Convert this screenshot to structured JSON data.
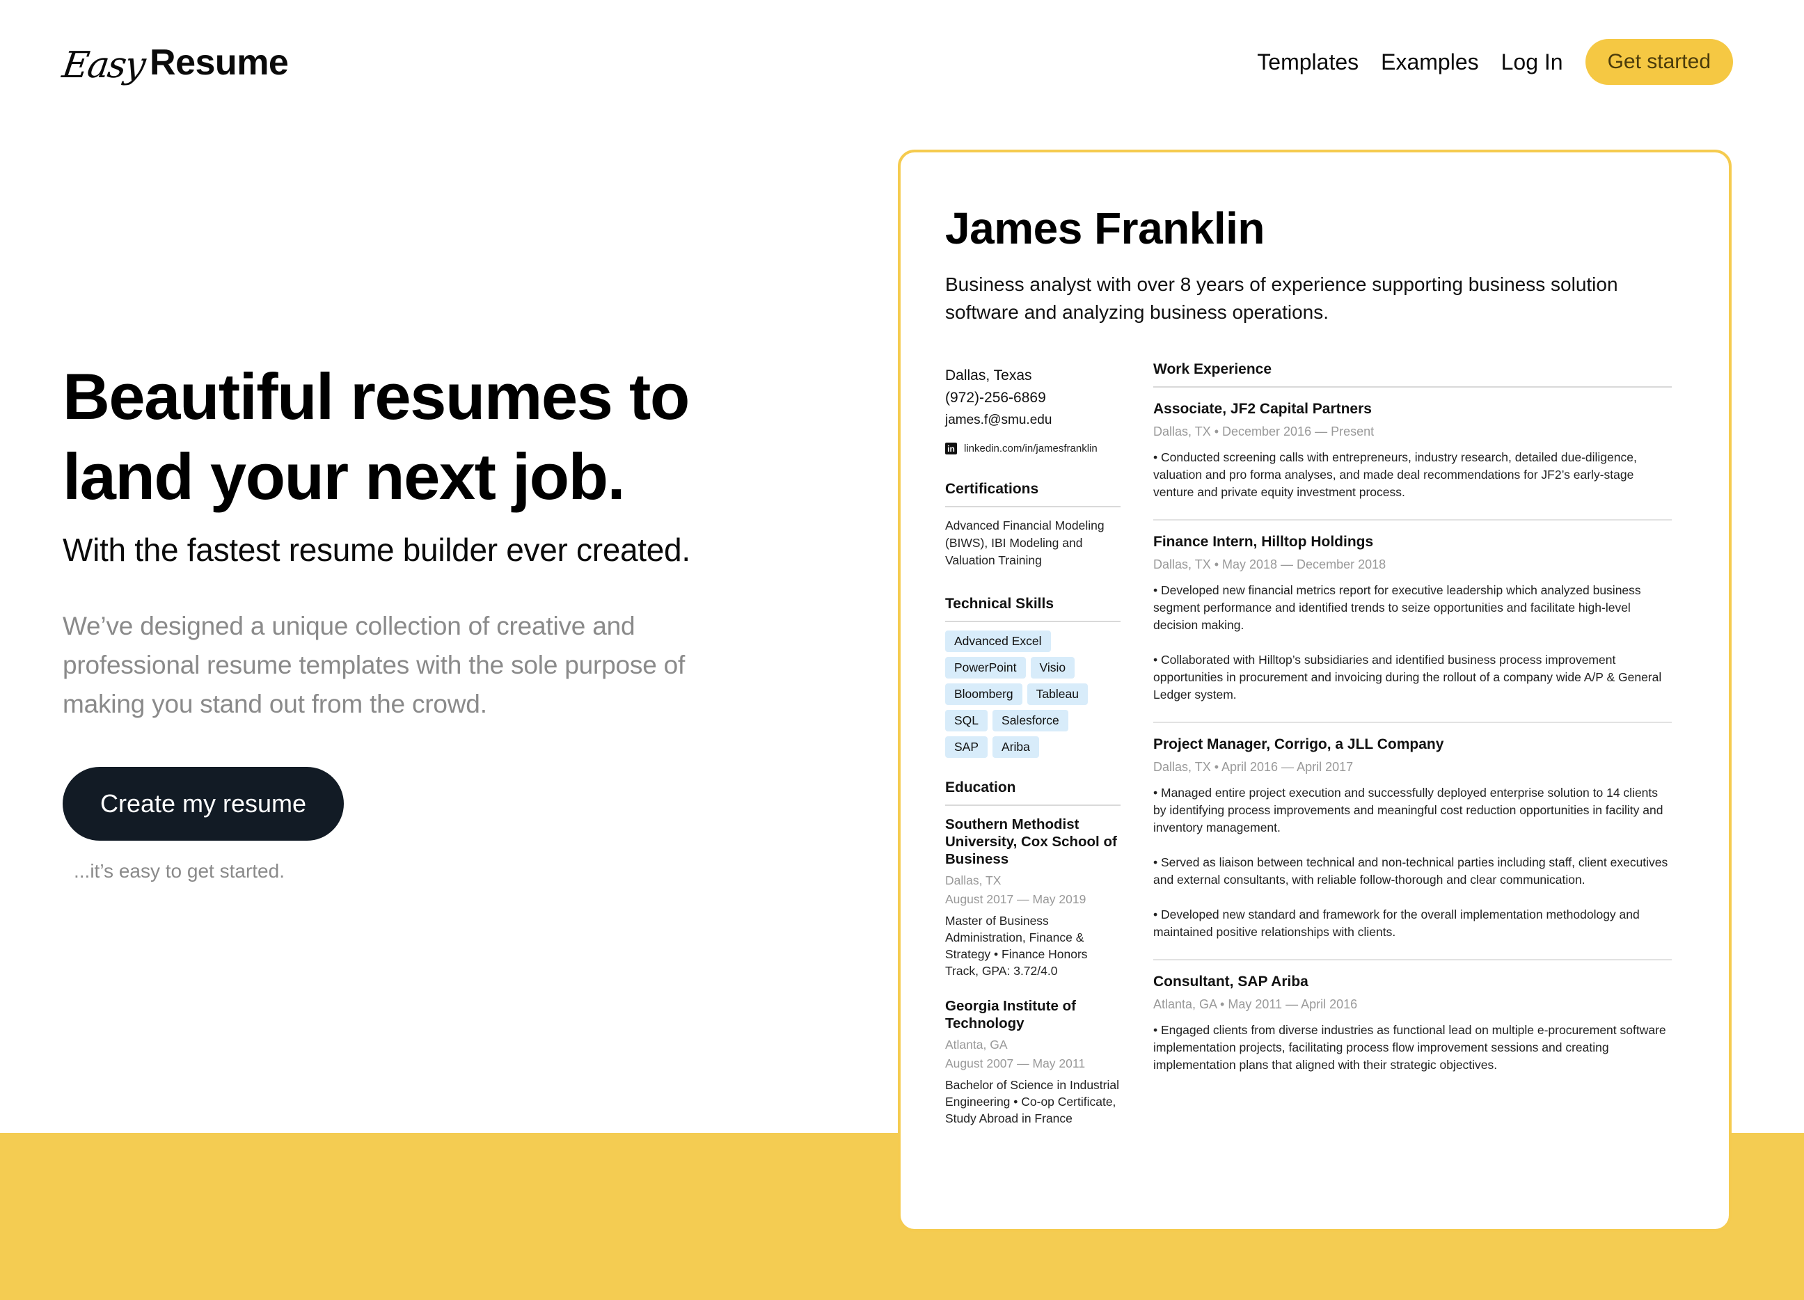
{
  "brand": {
    "script": "Easy",
    "bold": "Resume",
    "accent_color": "#F4CC52",
    "dark_color": "#121B25"
  },
  "nav": {
    "links": [
      "Templates",
      "Examples",
      "Log In"
    ],
    "cta": "Get started"
  },
  "hero": {
    "title_line1": "Beautiful resumes to",
    "title_line2": "land your next job.",
    "subtitle": "With the fastest resume builder ever created.",
    "description": "We’ve designed a unique collection of creative and professional resume templates with the sole purpose of making you stand out from the crowd.",
    "button": "Create my resume",
    "note": "...it’s easy to get started."
  },
  "resume": {
    "name": "James Franklin",
    "summary": "Business analyst with over 8 years of experience supporting business solution software and analyzing business operations.",
    "contact": {
      "location": "Dallas, Texas",
      "phone": "(972)-256-6869",
      "email": "james.f@smu.edu",
      "linkedin": "linkedin.com/in/jamesfranklin",
      "linkedin_icon": "linkedin-icon"
    },
    "certifications": {
      "title": "Certifications",
      "text": "Advanced Financial Modeling (BIWS), IBI Modeling and Valuation Training"
    },
    "skills": {
      "title": "Technical Skills",
      "items": [
        "Advanced Excel",
        "PowerPoint",
        "Visio",
        "Bloomberg",
        "Tableau",
        "SQL",
        "Salesforce",
        "SAP",
        "Ariba"
      ]
    },
    "education": {
      "title": "Education",
      "items": [
        {
          "school": "Southern Methodist University, Cox School of Business",
          "location": "Dallas, TX",
          "dates": "August 2017 — May 2019",
          "degree": "Master of Business Administration, Finance & Strategy • Finance Honors Track, GPA: 3.72/4.0"
        },
        {
          "school": "Georgia Institute of Technology",
          "location": "Atlanta, GA",
          "dates": "August 2007 — May 2011",
          "degree": "Bachelor of Science in Industrial Engineering • Co-op Certificate, Study Abroad in France"
        }
      ]
    },
    "work": {
      "title": "Work Experience",
      "jobs": [
        {
          "title": "Associate, JF2 Capital Partners",
          "meta": "Dallas, TX • December 2016 — Present",
          "bullets": [
            "• Conducted screening calls with entrepreneurs, industry research, detailed due-diligence, valuation and pro forma analyses, and made deal recommendations for JF2’s early-stage venture and private equity investment process."
          ]
        },
        {
          "title": "Finance Intern, Hilltop Holdings",
          "meta": "Dallas, TX • May 2018 — December 2018",
          "bullets": [
            "• Developed new financial metrics report for executive leadership which analyzed business segment performance and identified trends to seize opportunities and facilitate high-level decision making.",
            "• Collaborated with Hilltop’s subsidiaries and identified business process improvement opportunities in procurement and invoicing during the rollout of a company wide A/P & General Ledger system."
          ]
        },
        {
          "title": "Project Manager, Corrigo, a JLL Company",
          "meta": "Dallas, TX • April 2016 — April 2017",
          "bullets": [
            "• Managed entire project execution and successfully deployed enterprise solution to 14 clients by identifying process improvements and meaningful cost reduction opportunities in facility and inventory management.",
            "• Served as liaison between technical and non-technical parties including staff, client executives and external consultants, with reliable follow-thorough and clear communication.",
            "• Developed new standard and framework for the overall implementation methodology and\nmaintained positive relationships with clients."
          ]
        },
        {
          "title": "Consultant, SAP Ariba",
          "meta": "Atlanta, GA • May 2011 — April 2016",
          "bullets": [
            "• Engaged clients from diverse industries as functional lead on multiple e-procurement software implementation projects, facilitating process flow improvement sessions and creating implementation plans that aligned with their strategic objectives."
          ]
        }
      ]
    }
  }
}
